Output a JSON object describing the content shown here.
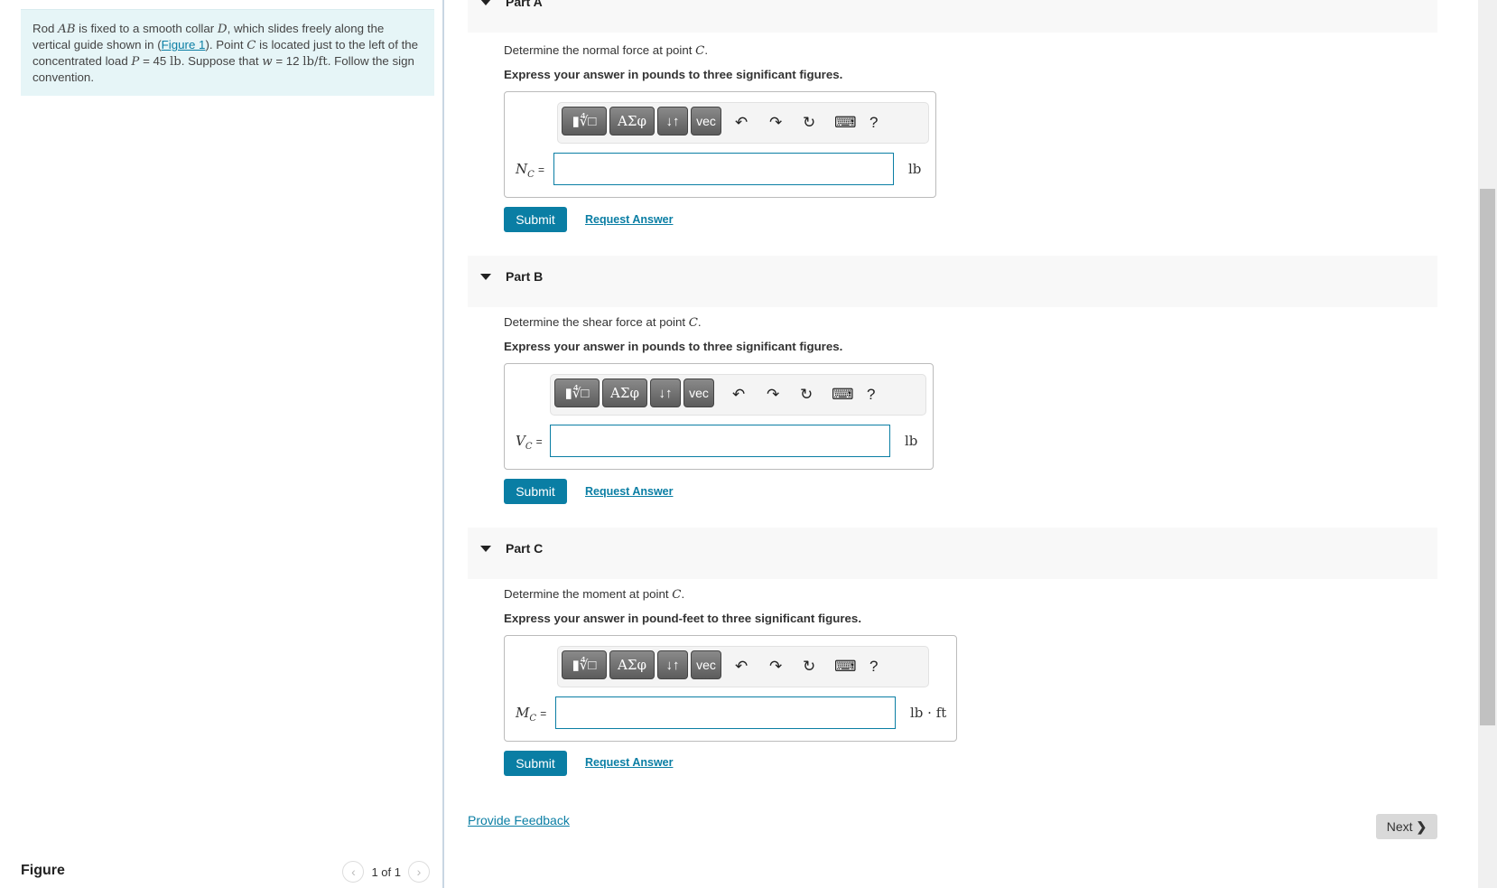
{
  "problem": {
    "segments": [
      {
        "t": "Rod ",
        "m": false
      },
      {
        "t": "AB",
        "m": true
      },
      {
        "t": " is fixed to a smooth collar ",
        "m": false
      },
      {
        "t": "D",
        "m": true
      },
      {
        "t": ", which slides freely along the vertical guide shown in (",
        "m": false
      },
      {
        "t": "Figure 1",
        "link": true
      },
      {
        "t": "). Point ",
        "m": false
      },
      {
        "t": "C",
        "m": true
      },
      {
        "t": " is located just to the left of the concentrated load ",
        "m": false
      },
      {
        "t": "P",
        "m": true
      },
      {
        "t": " = 45 ",
        "m": false
      },
      {
        "t": "lb",
        "mr": true
      },
      {
        "t": ". Suppose that ",
        "m": false
      },
      {
        "t": "w",
        "m": true
      },
      {
        "t": " = 12 ",
        "m": false
      },
      {
        "t": "lb/ft",
        "mr": true
      },
      {
        "t": ". Follow the sign convention.",
        "m": false
      }
    ]
  },
  "figure": {
    "title": "Figure",
    "pager": "1 of 1",
    "prev_icon": "‹",
    "next_icon": "›"
  },
  "toolbar": {
    "templates": "▮∜□",
    "greek": "ΑΣφ",
    "arrows": "↓↑",
    "vec": "vec",
    "undo": "↶",
    "redo": "↷",
    "reset": "↻",
    "keyboard": "⌨",
    "help": "?"
  },
  "parts": [
    {
      "title": "Part A",
      "question": "Determine the normal force at point ",
      "question_var": "C",
      "instruction": "Express your answer in pounds to three significant figures.",
      "var": "N",
      "sub": "C",
      "eq": "=",
      "value": "",
      "unit": "lb",
      "submit": "Submit",
      "request": "Request Answer"
    },
    {
      "title": "Part B",
      "question": "Determine the shear force at point ",
      "question_var": "C",
      "instruction": "Express your answer in pounds to three significant figures.",
      "var": "V",
      "sub": "C",
      "eq": "=",
      "value": "",
      "unit": "lb",
      "submit": "Submit",
      "request": "Request Answer"
    },
    {
      "title": "Part C",
      "question": "Determine the moment at point ",
      "question_var": "C",
      "instruction": "Express your answer in pound-feet to three significant figures.",
      "var": "M",
      "sub": "C",
      "eq": "=",
      "value": "",
      "unit": "lb · ft",
      "submit": "Submit",
      "request": "Request Answer"
    }
  ],
  "footer": {
    "feedback": "Provide Feedback",
    "next": "Next",
    "next_icon": "❯"
  }
}
